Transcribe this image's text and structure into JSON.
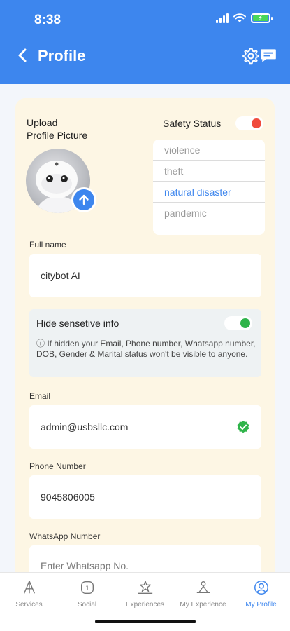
{
  "status_bar": {
    "time": "8:38"
  },
  "header": {
    "title": "Profile"
  },
  "profile": {
    "upload_label_line1": "Upload",
    "upload_label_line2": "Profile Picture",
    "safety_status_label": "Safety Status",
    "safety_options": [
      {
        "label": "violence",
        "selected": false
      },
      {
        "label": "theft",
        "selected": false
      },
      {
        "label": "natural disaster",
        "selected": true
      },
      {
        "label": "pandemic",
        "selected": false
      }
    ],
    "full_name_label": "Full name",
    "full_name_value": "citybot AI",
    "hide_info_label": "Hide sensetive info",
    "hide_info_note": "ⓘ If hidden your Email, Phone number, Whatsapp number, DOB, Gender & Marital status won't be visible to anyone.",
    "email_label": "Email",
    "email_value": "admin@usbsllc.com",
    "phone_label": "Phone Number",
    "phone_value": "9045806005",
    "whatsapp_label": "WhatsApp Number",
    "whatsapp_placeholder": "Enter Whatsapp No."
  },
  "tabs": [
    {
      "label": "Services",
      "icon": "services-icon"
    },
    {
      "label": "Social",
      "icon": "social-icon"
    },
    {
      "label": "Experiences",
      "icon": "experiences-icon"
    },
    {
      "label": "My Experience",
      "icon": "my-experience-icon"
    },
    {
      "label": "My Profile",
      "icon": "my-profile-icon",
      "active": true
    }
  ],
  "colors": {
    "primary": "#3d86ee",
    "card_bg": "#fdf6e4",
    "safety_toggle": "#f04a3c",
    "hide_toggle": "#2fb44a"
  }
}
